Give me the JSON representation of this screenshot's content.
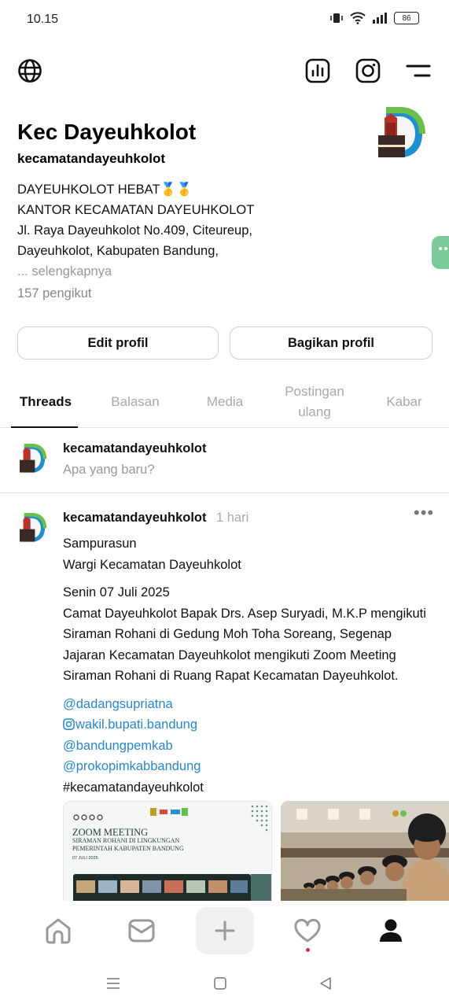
{
  "status_bar": {
    "time": "10.15",
    "battery": "86"
  },
  "profile": {
    "name": "Kec Dayeuhkolot",
    "handle": "kecamatandayeuhkolot",
    "bio_lines": [
      "DAYEUHKOLOT HEBAT🥇🥇",
      "KANTOR KECAMATAN DAYEUHKOLOT",
      "Jl. Raya Dayeuhkolot No.409, Citeureup,",
      "Dayeuhkolot, Kabupaten Bandung,"
    ],
    "bio_more": "... selengkapnya",
    "followers": "157 pengikut"
  },
  "buttons": {
    "edit": "Edit profil",
    "share": "Bagikan profil"
  },
  "tabs": [
    {
      "label": "Threads",
      "active": true
    },
    {
      "label": "Balasan",
      "active": false
    },
    {
      "label": "Media",
      "active": false
    },
    {
      "label": "Postingan ulang",
      "active": false
    },
    {
      "label": "Kabar",
      "active": false
    }
  ],
  "composer": {
    "handle": "kecamatandayeuhkolot",
    "placeholder": "Apa yang baru?"
  },
  "post": {
    "handle": "kecamatandayeuhkolot",
    "time": "1 hari",
    "lines_1": [
      "Sampurasun",
      "Wargi Kecamatan Dayeuhkolot"
    ],
    "lines_2": [
      "Senin 07 Juli 2025",
      "Camat Dayeuhkolot Bapak Drs. Asep Suryadi, M.K.P mengikuti",
      "Siraman Rohani di Gedung Moh Toha Soreang, Segenap",
      "Jajaran Kecamatan Dayeuhkolot mengikuti Zoom Meeting",
      "Siraman Rohani di Ruang Rapat Kecamatan Dayeuhkolot."
    ],
    "mentions": [
      "@dadangsupriatna",
      "wakil.bupati.bandung",
      "@bandungpemkab",
      "@prokopimkabbandung"
    ],
    "hashtag": "#kecamatandayeuhkolot",
    "media_1": {
      "title": "ZOOM MEETING",
      "subtitle_1": "SIRAMAN ROHANI DI LINGKUNGAN",
      "subtitle_2": "PEMERINTAH KABUPATEN BANDUNG",
      "date": "07 JULI 2025"
    }
  },
  "colors": {
    "accent_link": "#2b86c5",
    "logo_green": "#6ac04a",
    "logo_blue": "#1e8fd1",
    "notif_dot": "#e0245e"
  }
}
